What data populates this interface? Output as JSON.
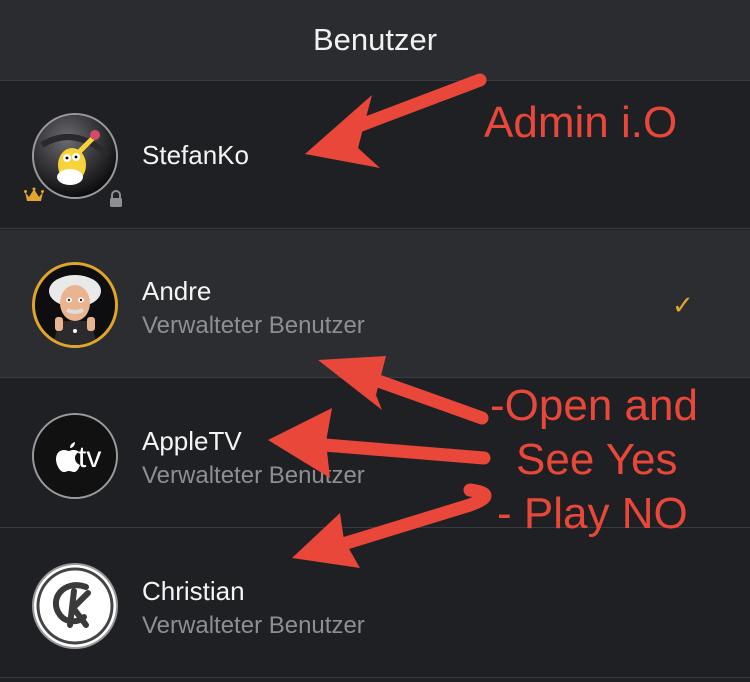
{
  "header": {
    "title": "Benutzer"
  },
  "users": [
    {
      "name": "StefanKo",
      "subtitle": "",
      "selected": false,
      "avatar_icon": "homer-avatar-icon",
      "badges": [
        "crown-icon",
        "lock-icon"
      ]
    },
    {
      "name": "Andre",
      "subtitle": "Verwalteter Benutzer",
      "selected": true,
      "avatar_icon": "einstein-avatar-icon"
    },
    {
      "name": "AppleTV",
      "subtitle": "Verwalteter Benutzer",
      "selected": false,
      "avatar_icon": "apple-tv-avatar-icon",
      "avatar_text": "tv"
    },
    {
      "name": "Christian",
      "subtitle": "Verwalteter Benutzer",
      "selected": false,
      "avatar_icon": "ck-avatar-icon",
      "avatar_text": "CK"
    }
  ],
  "checkmark": "✓",
  "annotations": {
    "admin": "Admin i.O",
    "line1": "-Open and",
    "line2": "See Yes",
    "line3": "- Play NO"
  },
  "colors": {
    "accent": "#e0a52a",
    "annotation": "#e8473a",
    "background": "#1f2023",
    "selected_row": "#2c2d31"
  }
}
